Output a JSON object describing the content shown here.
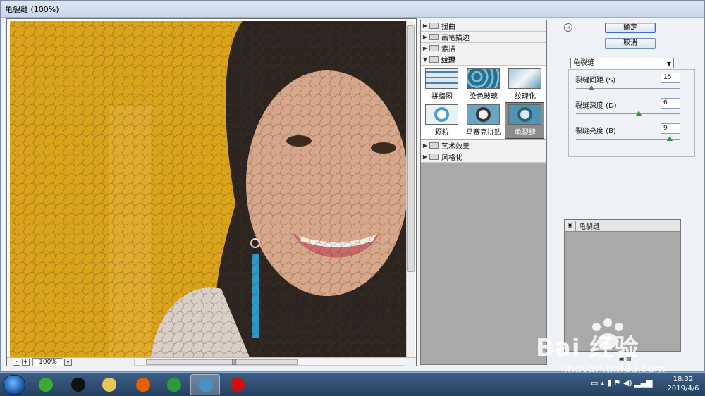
{
  "window": {
    "title": "龟裂缝 (100%)"
  },
  "preview": {
    "zoom_minus": "-",
    "zoom_plus": "+",
    "zoom_value": "100%",
    "zoom_dropdown": "▾",
    "hscroll_grip": "|||"
  },
  "filter_tree": {
    "categories_top": [
      {
        "label": "扭曲",
        "state": "collapsed"
      },
      {
        "label": "画笔描边",
        "state": "collapsed"
      },
      {
        "label": "素描",
        "state": "collapsed"
      },
      {
        "label": "纹理",
        "state": "expanded"
      }
    ],
    "tiles": [
      {
        "label": "拼缀图",
        "selected": false
      },
      {
        "label": "染色玻璃",
        "selected": false
      },
      {
        "label": "纹理化",
        "selected": false
      },
      {
        "label": "颗粒",
        "selected": false
      },
      {
        "label": "马赛克拼贴",
        "selected": false
      },
      {
        "label": "龟裂缝",
        "selected": true
      }
    ],
    "categories_bottom": [
      {
        "label": "艺术效果",
        "state": "collapsed"
      },
      {
        "label": "风格化",
        "state": "collapsed"
      }
    ]
  },
  "settings": {
    "collapse_icon": "«",
    "ok_label": "确定",
    "cancel_label": "取消",
    "filter_select": "龟裂缝",
    "params": [
      {
        "label": "裂缝间距 (S)",
        "value": "15",
        "fraction": 0.15
      },
      {
        "label": "裂缝深度 (D)",
        "value": "6",
        "fraction": 0.6
      },
      {
        "label": "裂缝亮度 (B)",
        "value": "9",
        "fraction": 0.9
      }
    ],
    "layer_name": "龟裂缝"
  },
  "watermark": {
    "brand": "Bai  经验",
    "url": "jingyan.baidu.com"
  },
  "taskbar": {
    "clock_time": "18:32",
    "clock_date": "2019/4/6",
    "colors": {
      "ie": "#3aa935",
      "qq": "#111111",
      "explorer": "#e8c45a",
      "firefox": "#e66000",
      "player": "#2b9b3a",
      "photoshop": "#4a90c8",
      "record": "#d01010"
    }
  }
}
